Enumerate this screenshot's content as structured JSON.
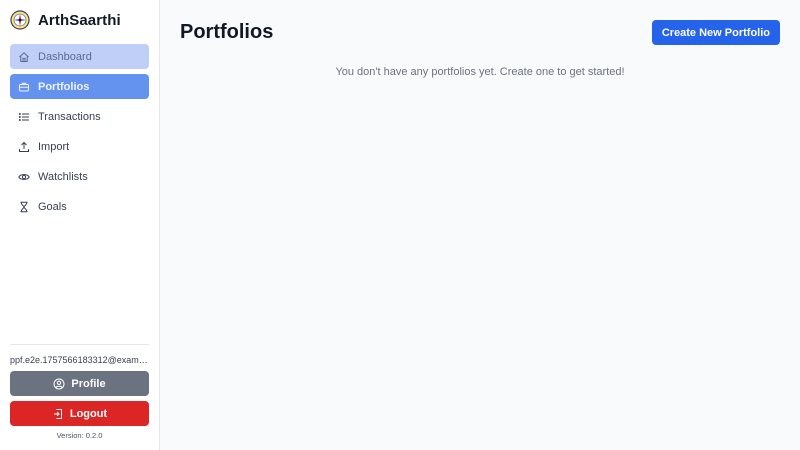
{
  "app": {
    "name": "ArthSaarthi",
    "logo_icon": "compass-logo-icon"
  },
  "sidebar": {
    "items": [
      {
        "label": "Dashboard",
        "icon": "home-icon"
      },
      {
        "label": "Portfolios",
        "icon": "briefcase-icon"
      },
      {
        "label": "Transactions",
        "icon": "list-icon"
      },
      {
        "label": "Import",
        "icon": "upload-icon"
      },
      {
        "label": "Watchlists",
        "icon": "eye-icon"
      },
      {
        "label": "Goals",
        "icon": "hourglass-icon"
      }
    ],
    "active_item": "Portfolios",
    "user_email": "ppf.e2e.1757566183312@example.com",
    "profile_label": "Profile",
    "logout_label": "Logout",
    "version": "Version: 0.2.0"
  },
  "main": {
    "title": "Portfolios",
    "create_button_label": "Create New Portfolio",
    "empty_message": "You don't have any portfolios yet. Create one to get started!"
  },
  "colors": {
    "primary": "#2563eb",
    "active_nav": "#6393ef",
    "dashboard_nav": "#bfcff7",
    "profile_button": "#6b7280",
    "logout_button": "#dc2626",
    "background": "#f9fafb"
  }
}
